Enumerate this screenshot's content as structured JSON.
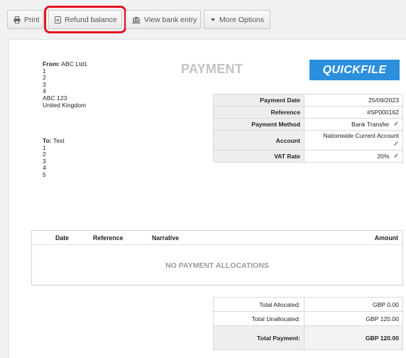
{
  "toolbar": {
    "print": "Print",
    "refund": "Refund balance",
    "bank": "View bank entry",
    "more": "More Options"
  },
  "doc": {
    "title": "PAYMENT",
    "logo": "QUICKFILE",
    "from": {
      "label": "From:",
      "name": "ABC Ltd1",
      "lines": [
        "1",
        "2",
        "3",
        "4",
        "ABC 123",
        "United Kingdom"
      ]
    },
    "to": {
      "label": "To:",
      "name": "Test",
      "lines": [
        "1",
        "2",
        "3",
        "4",
        "5"
      ]
    },
    "details": {
      "payment_date_label": "Payment Date",
      "payment_date": "25/09/2023",
      "reference_label": "Reference",
      "reference": "#SP000162",
      "method_label": "Payment Method",
      "method": "Bank Transfer",
      "account_label": "Account",
      "account": "Nationwide Current Account",
      "vat_label": "VAT Rate",
      "vat": "20%"
    },
    "allocations": {
      "col_date": "Date",
      "col_reference": "Reference",
      "col_narrative": "Narrative",
      "col_amount": "Amount",
      "empty": "NO PAYMENT ALLOCATIONS"
    },
    "totals": {
      "allocated_label": "Total Allocated:",
      "allocated": "GBP 0.00",
      "unallocated_label": "Total Unallocated:",
      "unallocated": "GBP 120.00",
      "payment_label": "Total Payment:",
      "payment": "GBP 120.00"
    }
  }
}
